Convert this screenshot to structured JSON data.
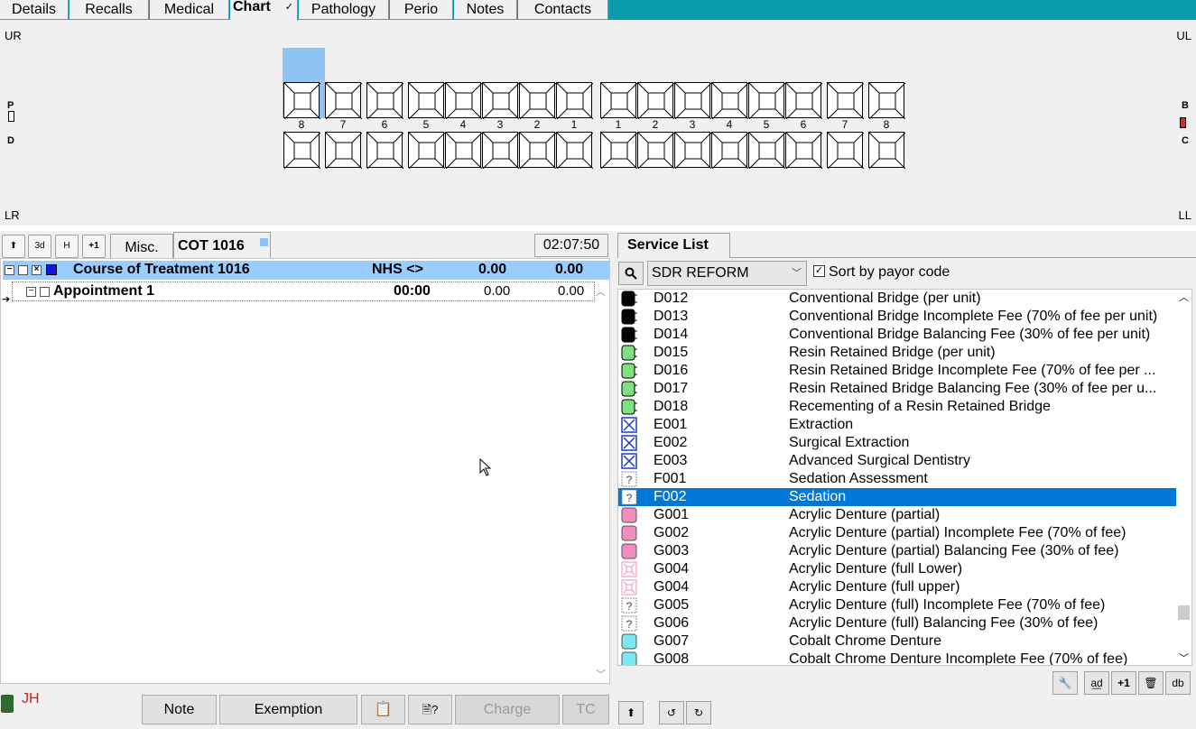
{
  "tabs": [
    {
      "label": "Details"
    },
    {
      "label": "Recalls"
    },
    {
      "label": "Medical"
    },
    {
      "label": "Chart",
      "active": true
    },
    {
      "label": "Pathology"
    },
    {
      "label": "Perio"
    },
    {
      "label": "Notes"
    },
    {
      "label": "Contacts"
    }
  ],
  "chart": {
    "quadrants": {
      "ur": "UR",
      "ul": "UL",
      "lr": "LR",
      "ll": "LL"
    },
    "side_left": {
      "top": "P",
      "bottom": "D"
    },
    "side_right": {
      "top": "B",
      "bottom": "C"
    },
    "upper_right_numbers": [
      "8",
      "7",
      "6",
      "5",
      "4",
      "3",
      "2",
      "1"
    ],
    "upper_left_numbers": [
      "1",
      "2",
      "3",
      "4",
      "5",
      "6",
      "7",
      "8"
    ]
  },
  "left": {
    "toolbar": {
      "up_icon": "up-arrow-icon",
      "btn_3d": "3d",
      "btn_h": "H",
      "btn_plus1": "+1"
    },
    "tabs": {
      "misc": "Misc.",
      "cot": "COT 1016"
    },
    "timer": "02:07:50",
    "course": {
      "title": "Course of Treatment 1016",
      "scheme": "NHS <>",
      "amount1": "0.00",
      "amount2": "0.00"
    },
    "appointment": {
      "title": "Appointment 1",
      "time": "00:00",
      "amount1": "0.00",
      "amount2": "0.00"
    },
    "initials": "JH",
    "buttons": {
      "note": "Note",
      "exemption": "Exemption",
      "charge": "Charge",
      "tc": "TC"
    }
  },
  "right": {
    "tab_title": "Service List",
    "payor": "SDR REFORM",
    "sort_label": "Sort by payor code",
    "sort_checked": true,
    "services": [
      {
        "code": "D012",
        "desc": "Conventional Bridge (per unit)",
        "icon": "black-bridge-icon",
        "color": "#000000"
      },
      {
        "code": "D013",
        "desc": "Conventional Bridge Incomplete Fee (70% of fee per unit)",
        "icon": "black-bridge-icon",
        "color": "#000000"
      },
      {
        "code": "D014",
        "desc": "Conventional Bridge Balancing Fee (30% of fee per unit)",
        "icon": "black-bridge-icon",
        "color": "#000000"
      },
      {
        "code": "D015",
        "desc": "Resin Retained Bridge (per unit)",
        "icon": "green-bridge-icon",
        "color": "#7ee07e"
      },
      {
        "code": "D016",
        "desc": "Resin Retained Bridge Incomplete Fee (70% of fee per ...",
        "icon": "green-bridge-icon",
        "color": "#7ee07e"
      },
      {
        "code": "D017",
        "desc": "Resin Retained Bridge Balancing Fee (30% of fee per u...",
        "icon": "green-bridge-icon",
        "color": "#7ee07e"
      },
      {
        "code": "D018",
        "desc": "Recementing of a Resin Retained Bridge",
        "icon": "green-bridge-icon",
        "color": "#7ee07e"
      },
      {
        "code": "E001",
        "desc": "Extraction",
        "icon": "extraction-icon",
        "color": "#1a3cc8"
      },
      {
        "code": "E002",
        "desc": "Surgical Extraction",
        "icon": "extraction-icon",
        "color": "#1a3cc8"
      },
      {
        "code": "E003",
        "desc": "Advanced Surgical Dentistry",
        "icon": "extraction-icon",
        "color": "#1a3cc8"
      },
      {
        "code": "F001",
        "desc": "Sedation Assessment",
        "icon": "question-icon",
        "color": "#888888"
      },
      {
        "code": "F002",
        "desc": "Sedation",
        "icon": "question-icon",
        "color": "#888888",
        "selected": true
      },
      {
        "code": "G001",
        "desc": "Acrylic Denture (partial)",
        "icon": "pink-denture-icon",
        "color": "#f08cc0"
      },
      {
        "code": "G002",
        "desc": "Acrylic Denture (partial) Incomplete Fee (70% of fee)",
        "icon": "pink-denture-icon",
        "color": "#f08cc0"
      },
      {
        "code": "G003",
        "desc": "Acrylic Denture (partial) Balancing Fee (30% of fee)",
        "icon": "pink-denture-icon",
        "color": "#f08cc0"
      },
      {
        "code": "G004",
        "desc": "Acrylic Denture (full Lower)",
        "icon": "pink-full-denture-icon",
        "color": "#f08cc0"
      },
      {
        "code": "G004",
        "desc": "Acrylic Denture (full upper)",
        "icon": "pink-full-denture-icon",
        "color": "#f08cc0"
      },
      {
        "code": "G005",
        "desc": "Acrylic Denture (full) Incomplete Fee (70% of fee)",
        "icon": "question-icon",
        "color": "#888888"
      },
      {
        "code": "G006",
        "desc": "Acrylic Denture (full) Balancing Fee (30% of fee)",
        "icon": "question-icon",
        "color": "#888888"
      },
      {
        "code": "G007",
        "desc": "Cobalt Chrome Denture",
        "icon": "cyan-denture-icon",
        "color": "#7ae8f0"
      },
      {
        "code": "G008",
        "desc": "Cobalt Chrome Denture Incomplete Fee (70% of fee)",
        "icon": "cyan-denture-icon",
        "color": "#7ae8f0"
      }
    ],
    "tool_buttons": [
      "wrench-icon",
      "add-icon",
      "+1",
      "trash-icon",
      "db"
    ],
    "bottom_buttons": [
      "up-arrow-icon",
      "undo-icon",
      "redo-icon"
    ]
  }
}
